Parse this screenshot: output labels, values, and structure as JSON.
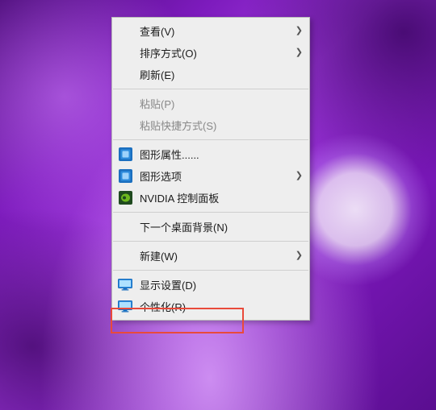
{
  "menu": {
    "groups": [
      [
        {
          "id": "view",
          "label": "查看(V)",
          "submenu": true,
          "disabled": false,
          "icon": null
        },
        {
          "id": "sort",
          "label": "排序方式(O)",
          "submenu": true,
          "disabled": false,
          "icon": null
        },
        {
          "id": "refresh",
          "label": "刷新(E)",
          "submenu": false,
          "disabled": false,
          "icon": null
        }
      ],
      [
        {
          "id": "paste",
          "label": "粘贴(P)",
          "submenu": false,
          "disabled": true,
          "icon": null
        },
        {
          "id": "paste-shortcut",
          "label": "粘贴快捷方式(S)",
          "submenu": false,
          "disabled": true,
          "icon": null
        }
      ],
      [
        {
          "id": "gfx-props",
          "label": "图形属性......",
          "submenu": false,
          "disabled": false,
          "icon": "intel"
        },
        {
          "id": "gfx-options",
          "label": "图形选项",
          "submenu": true,
          "disabled": false,
          "icon": "intel"
        },
        {
          "id": "nvidia-panel",
          "label": "NVIDIA 控制面板",
          "submenu": false,
          "disabled": false,
          "icon": "nvidia"
        }
      ],
      [
        {
          "id": "next-bg",
          "label": "下一个桌面背景(N)",
          "submenu": false,
          "disabled": false,
          "icon": null
        }
      ],
      [
        {
          "id": "new",
          "label": "新建(W)",
          "submenu": true,
          "disabled": false,
          "icon": null
        }
      ],
      [
        {
          "id": "display-settings",
          "label": "显示设置(D)",
          "submenu": false,
          "disabled": false,
          "icon": "monitor"
        },
        {
          "id": "personalize",
          "label": "个性化(R)",
          "submenu": false,
          "disabled": false,
          "icon": "monitor"
        }
      ]
    ],
    "arrow_glyph": "❯"
  },
  "highlight_target": "personalize"
}
